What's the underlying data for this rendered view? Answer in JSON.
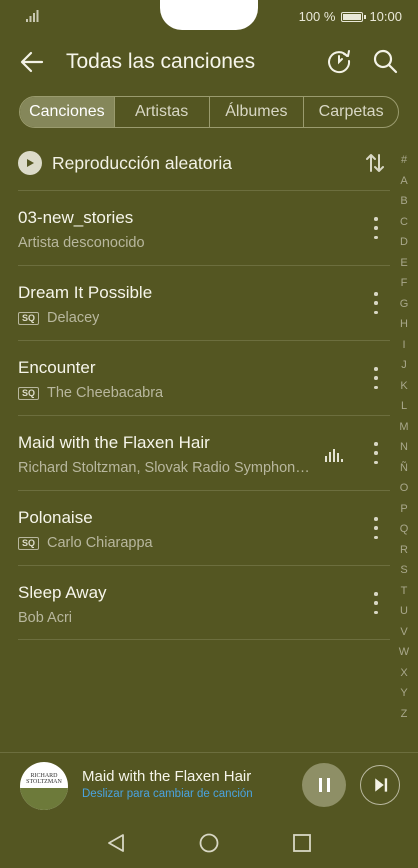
{
  "status_bar": {
    "battery_text": "100 %",
    "time": "10:00",
    "signal_icon": "signal-icon",
    "battery_icon": "battery-icon"
  },
  "header": {
    "title": "Todas las canciones",
    "back_icon": "arrow-left-icon",
    "refresh_icon": "refresh-icon",
    "search_icon": "search-icon"
  },
  "tabs": [
    {
      "label": "Canciones",
      "active": true
    },
    {
      "label": "Artistas",
      "active": false
    },
    {
      "label": "Álbumes",
      "active": false
    },
    {
      "label": "Carpetas",
      "active": false
    }
  ],
  "shuffle": {
    "label": "Reproducción aleatoria",
    "sort_icon": "sort-icon"
  },
  "songs": [
    {
      "title": "03-new_stories",
      "artist": "Artista desconocido",
      "sq": false,
      "playing": false
    },
    {
      "title": "Dream It Possible",
      "artist": "Delacey",
      "sq": true,
      "playing": false
    },
    {
      "title": "Encounter",
      "artist": "The Cheebacabra",
      "sq": true,
      "playing": false
    },
    {
      "title": "Maid with the Flaxen Hair",
      "artist": "Richard Stoltzman, Slovak Radio Symphony Orchestra",
      "sq": false,
      "playing": true
    },
    {
      "title": "Polonaise",
      "artist": "Carlo Chiarappa",
      "sq": true,
      "playing": false
    },
    {
      "title": "Sleep Away",
      "artist": "Bob Acri",
      "sq": false,
      "playing": false
    }
  ],
  "sq_label": "SQ",
  "alpha_index": [
    "#",
    "A",
    "B",
    "C",
    "D",
    "E",
    "F",
    "G",
    "H",
    "I",
    "J",
    "K",
    "L",
    "M",
    "N",
    "Ñ",
    "O",
    "P",
    "Q",
    "R",
    "S",
    "T",
    "U",
    "V",
    "W",
    "X",
    "Y",
    "Z"
  ],
  "now_playing": {
    "title": "Maid with the Flaxen Hair",
    "hint": "Deslizar para cambiar de canción",
    "album_art_text": "RICHARD STOLTZMAN",
    "pause_icon": "pause-icon",
    "next_icon": "skip-next-icon"
  },
  "nav_bar": {
    "back_icon": "nav-back-icon",
    "home_icon": "nav-home-icon",
    "recents_icon": "nav-recents-icon"
  },
  "colors": {
    "background": "#545622",
    "active_tab": "#85875a",
    "accent_link": "#4aa3df"
  }
}
